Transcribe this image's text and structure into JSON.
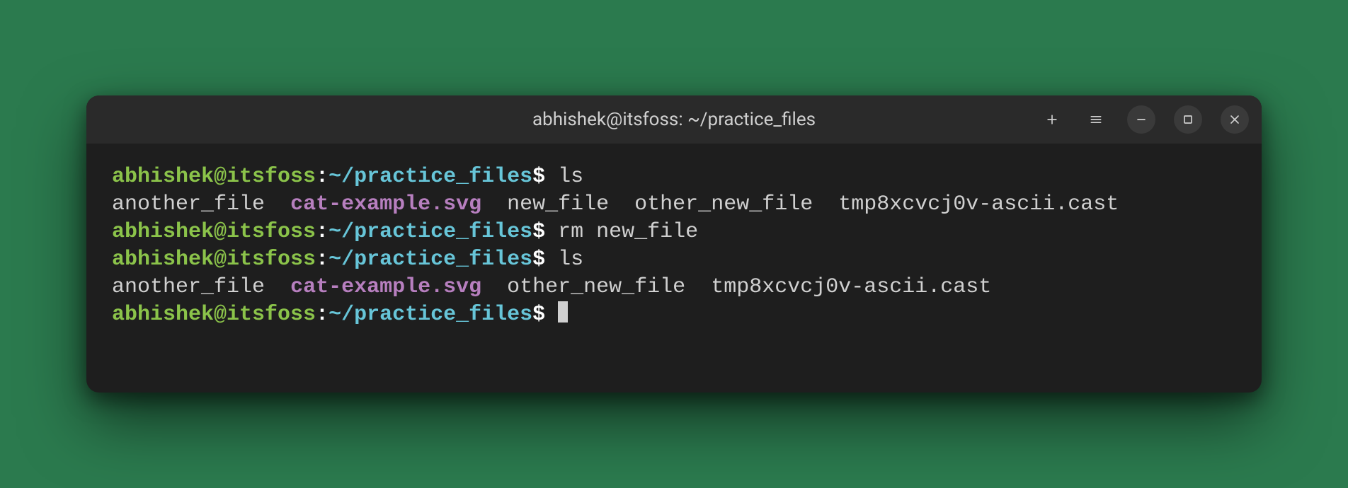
{
  "title": "abhishek@itsfoss: ~/practice_files",
  "prompt": {
    "user_host": "abhishek@itsfoss",
    "sep1": ":",
    "path": "~/practice_files",
    "sigil": "$"
  },
  "commands": {
    "ls1": "ls",
    "rm": "rm new_file",
    "ls2": "ls"
  },
  "ls_output1": {
    "f1": "another_file",
    "f2": "cat-example.svg",
    "f3": "new_file",
    "f4": "other_new_file",
    "f5": "tmp8xcvcj0v-ascii.cast"
  },
  "ls_output2": {
    "f1": "another_file",
    "f2": "cat-example.svg",
    "f3": "other_new_file",
    "f4": "tmp8xcvcj0v-ascii.cast"
  },
  "spaces": {
    "s2": "  ",
    "s1": " "
  }
}
